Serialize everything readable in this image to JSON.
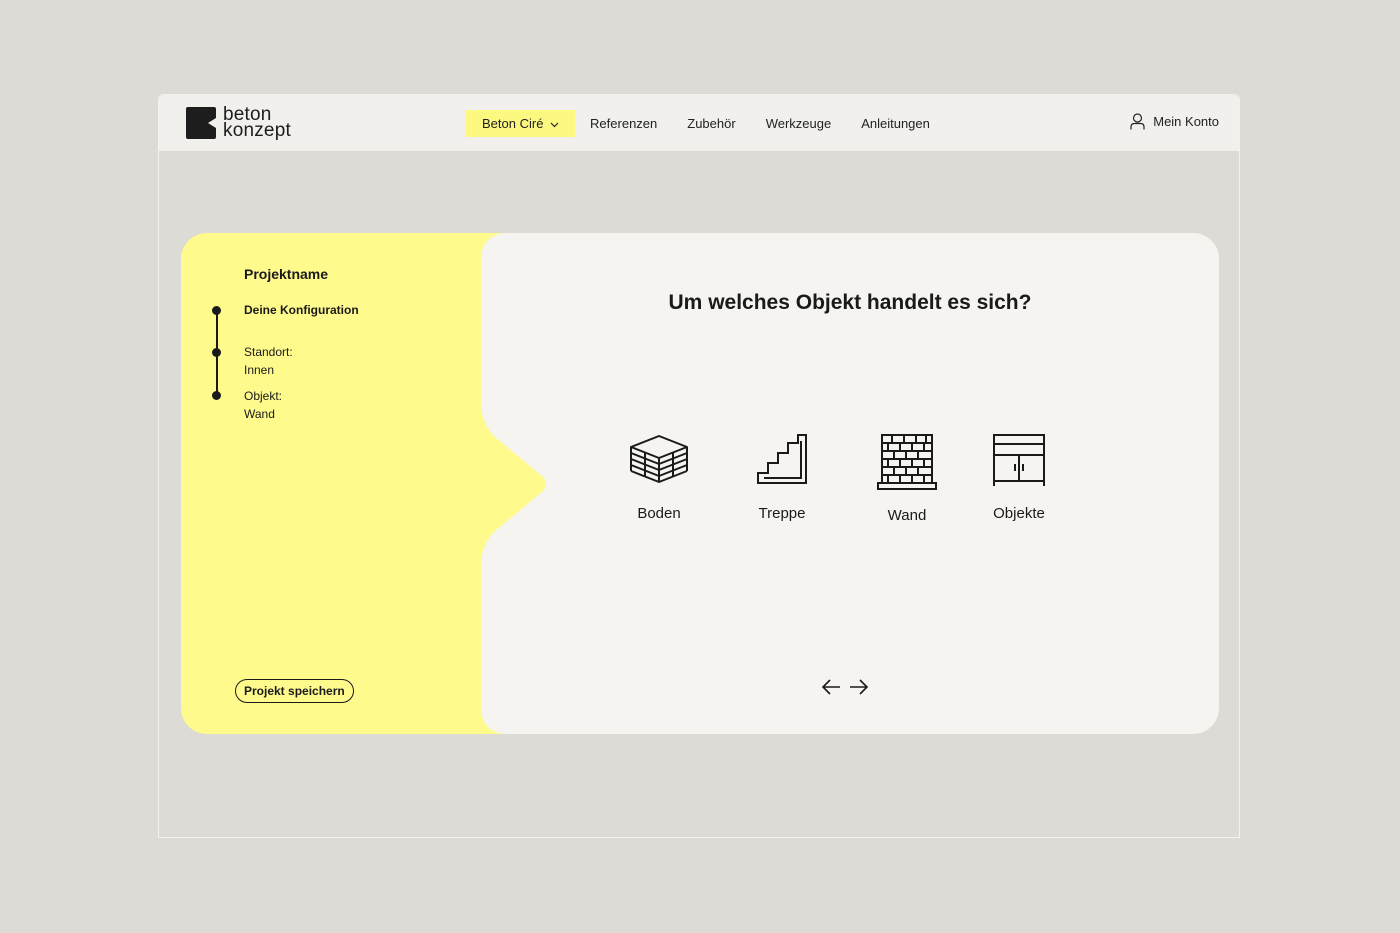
{
  "brand": {
    "line1": "beton",
    "line2": "konzept"
  },
  "nav": {
    "items": [
      {
        "label": "Beton Ciré",
        "active": true
      },
      {
        "label": "Referenzen"
      },
      {
        "label": "Zubehör"
      },
      {
        "label": "Werkzeuge"
      },
      {
        "label": "Anleitungen"
      }
    ]
  },
  "account": {
    "label": "Mein Konto",
    "icon": "user-icon"
  },
  "sidebar": {
    "title": "Projektname",
    "steps": [
      {
        "label": "Deine Konfiguration",
        "value": ""
      },
      {
        "label": "Standort:",
        "value": "Innen"
      },
      {
        "label": "Objekt:",
        "value": "Wand"
      }
    ],
    "save_label": "Projekt speichern"
  },
  "main": {
    "question": "Um welches Objekt handelt es sich?",
    "options": [
      {
        "label": "Boden",
        "icon": "floor-layers-icon"
      },
      {
        "label": "Treppe",
        "icon": "stairs-icon"
      },
      {
        "label": "Wand",
        "icon": "brick-wall-icon"
      },
      {
        "label": "Objekte",
        "icon": "cabinet-icon"
      }
    ]
  },
  "colors": {
    "accent": "#fdf880",
    "sidebar": "#fffa8c",
    "panel": "#f5f4f0",
    "background": "#dcdbd6"
  }
}
